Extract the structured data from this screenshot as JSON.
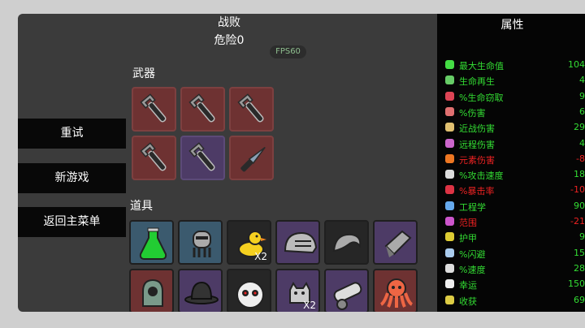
{
  "header": {
    "status": "战败",
    "danger": "危险0",
    "fps": "FPS60"
  },
  "sections": {
    "weapons": "武器",
    "items": "道具"
  },
  "menu": [
    "重试",
    "新游戏",
    "返回主菜单"
  ],
  "weapons": [
    {
      "name": "wrench",
      "tier": "red"
    },
    {
      "name": "wrench",
      "tier": "red"
    },
    {
      "name": "wrench",
      "tier": "red"
    },
    {
      "name": "wrench",
      "tier": "red"
    },
    {
      "name": "wrench",
      "tier": "purple"
    },
    {
      "name": "knife",
      "tier": "red"
    }
  ],
  "items": [
    {
      "icon": "potion-icon",
      "tier": "blue",
      "qty": ""
    },
    {
      "icon": "robot-icon",
      "tier": "blue",
      "qty": ""
    },
    {
      "icon": "duck-icon",
      "tier": "dark",
      "qty": "X2"
    },
    {
      "icon": "helmet-icon",
      "tier": "purple",
      "qty": ""
    },
    {
      "icon": "wave-icon",
      "tier": "dark",
      "qty": ""
    },
    {
      "icon": "crystal-icon",
      "tier": "purple",
      "qty": ""
    },
    {
      "icon": "alien-icon",
      "tier": "red",
      "qty": ""
    },
    {
      "icon": "hat-icon",
      "tier": "purple",
      "qty": ""
    },
    {
      "icon": "mask-icon",
      "tier": "dark",
      "qty": ""
    },
    {
      "icon": "cat-icon",
      "tier": "purple",
      "qty": "X2"
    },
    {
      "icon": "cannon-icon",
      "tier": "purple",
      "qty": ""
    },
    {
      "icon": "octopus-icon",
      "tier": "red",
      "qty": ""
    }
  ],
  "tiers": {
    "red": "#6e3232",
    "purple": "#4d3b66",
    "blue": "#3b5a6e",
    "dark": "#262626"
  },
  "stats_title": "属性",
  "stats": [
    {
      "label": "最大生命值",
      "value": "104",
      "color": "green",
      "icon": "heart-icon",
      "iconColor": "#44dd44"
    },
    {
      "label": "生命再生",
      "value": "4",
      "color": "green",
      "icon": "regen-icon",
      "iconColor": "#66cc66"
    },
    {
      "label": "%生命窃取",
      "value": "9",
      "color": "green",
      "icon": "fang-icon",
      "iconColor": "#dd4455"
    },
    {
      "label": "%伤害",
      "value": "6",
      "color": "green",
      "icon": "muscle-icon",
      "iconColor": "#e07070"
    },
    {
      "label": "近战伤害",
      "value": "29",
      "color": "green",
      "icon": "sword-icon",
      "iconColor": "#e0c070"
    },
    {
      "label": "远程伤害",
      "value": "4",
      "color": "green",
      "icon": "bow-icon",
      "iconColor": "#cc66cc"
    },
    {
      "label": "元素伤害",
      "value": "-8",
      "color": "red",
      "icon": "fire-icon",
      "iconColor": "#ee7722"
    },
    {
      "label": "%攻击速度",
      "value": "18",
      "color": "green",
      "icon": "hourglass-icon",
      "iconColor": "#dddddd"
    },
    {
      "label": "%暴击率",
      "value": "-10",
      "color": "red",
      "icon": "crit-icon",
      "iconColor": "#dd3344"
    },
    {
      "label": "工程学",
      "value": "90",
      "color": "green",
      "icon": "wrench-icon",
      "iconColor": "#66aaee"
    },
    {
      "label": "范围",
      "value": "-21",
      "color": "red",
      "icon": "range-icon",
      "iconColor": "#cc55cc"
    },
    {
      "label": "护甲",
      "value": "9",
      "color": "green",
      "icon": "shield-icon",
      "iconColor": "#ddcc33"
    },
    {
      "label": "%闪避",
      "value": "15",
      "color": "green",
      "icon": "dodge-icon",
      "iconColor": "#aaccee"
    },
    {
      "label": "%速度",
      "value": "28",
      "color": "green",
      "icon": "shoe-icon",
      "iconColor": "#dddddd"
    },
    {
      "label": "幸运",
      "value": "150",
      "color": "green",
      "icon": "dice-icon",
      "iconColor": "#eeeeee"
    },
    {
      "label": "收获",
      "value": "69",
      "color": "green",
      "icon": "harvest-icon",
      "iconColor": "#ddcc44"
    }
  ]
}
